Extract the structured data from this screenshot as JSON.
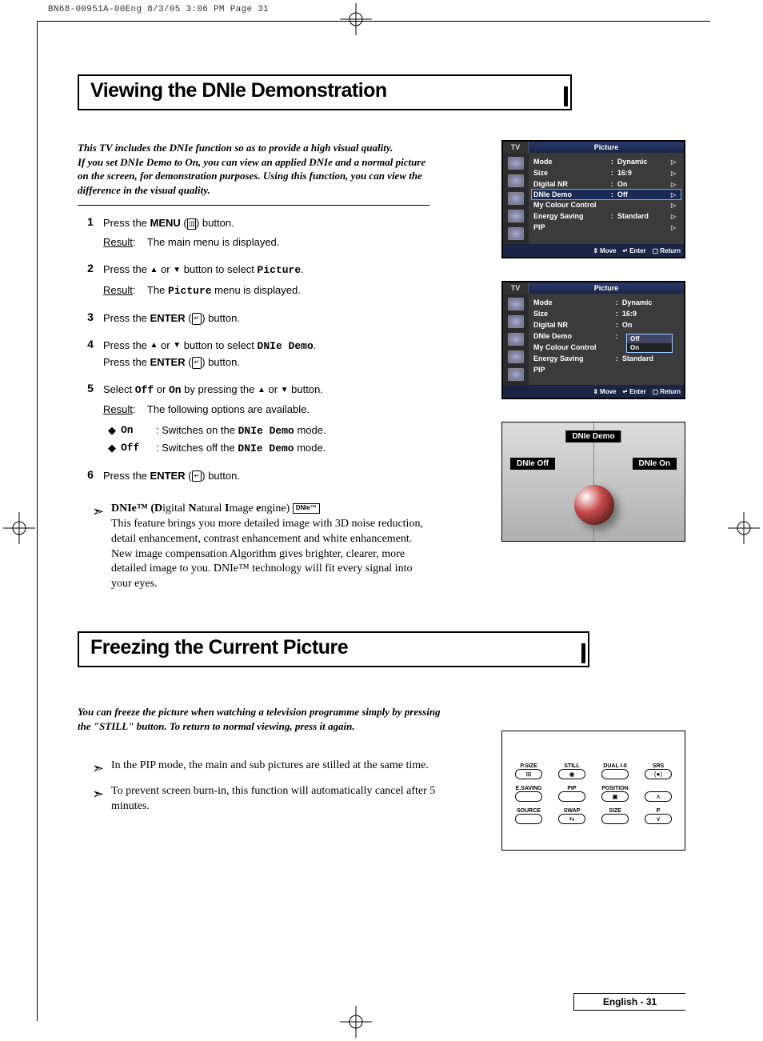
{
  "print_header": "BN68-00951A-00Eng  8/3/05  3:06 PM  Page 31",
  "section1": {
    "title": "Viewing the DNIe Demonstration",
    "intro": "This TV includes the DNIe function so as to provide a high visual quality.\nIf you set DNIe Demo to On, you can view an applied DNIe and a normal picture on the screen, for demonstration purposes. Using this function, you can view the difference in the visual quality.",
    "steps": [
      {
        "num": "1",
        "line1_pre": "Press the ",
        "line1_bold": "MENU",
        "line1_post": " (",
        "line1_icon": "menu",
        "line1_end": ") button.",
        "result_label": "Result",
        "result_text": "The main menu is displayed."
      },
      {
        "num": "2",
        "line1_pre": "Press the ",
        "line1_icon1": "▲",
        "line1_mid": " or ",
        "line1_icon2": "▼",
        "line1_post": " button to select ",
        "line1_mono": "Picture",
        "line1_end": ".",
        "result_label": "Result",
        "result_pre": "The ",
        "result_mono": "Picture",
        "result_post": " menu is displayed."
      },
      {
        "num": "3",
        "line1_pre": "Press the ",
        "line1_bold": "ENTER",
        "line1_post": " (",
        "line1_icon": "enter",
        "line1_end": ") button."
      },
      {
        "num": "4",
        "line1_pre": "Press the ",
        "line1_icon1": "▲",
        "line1_mid": " or ",
        "line1_icon2": "▼",
        "line1_post": " button to select ",
        "line1_mono": "DNIe Demo",
        "line1_end": ".",
        "line2_pre": "Press the ",
        "line2_bold": "ENTER",
        "line2_post": " (",
        "line2_icon": "enter",
        "line2_end": ") button."
      },
      {
        "num": "5",
        "line1_pre": "Select ",
        "line1_mono1": "Off",
        "line1_mid1": " or ",
        "line1_mono2": "On",
        "line1_mid2": " by pressing the ",
        "line1_icon1": "▲",
        "line1_mid3": " or ",
        "line1_icon2": "▼",
        "line1_end": " button.",
        "result_label": "Result",
        "result_text": "The following options are available.",
        "options": [
          {
            "key": "On",
            "val_pre": "Switches on the ",
            "val_mono": "DNIe Demo",
            "val_post": " mode."
          },
          {
            "key": "Off",
            "val_pre": "Switches off the ",
            "val_mono": "DNIe Demo",
            "val_post": " mode."
          }
        ]
      },
      {
        "num": "6",
        "line1_pre": "Press the ",
        "line1_bold": "ENTER",
        "line1_post": " (",
        "line1_icon": "enter",
        "line1_end": ") button."
      }
    ],
    "note": {
      "head_pre": "DNIe™ (",
      "head_d": "D",
      "head_1": "igital ",
      "head_n": "N",
      "head_2": "atural ",
      "head_i": "I",
      "head_3": "mage ",
      "head_e": "e",
      "head_4": "ngine) ",
      "badge": "DNIe™",
      "body": "This feature brings you more detailed image with 3D noise reduction, detail enhancement, contrast enhancement and white enhancement. New image compensation Algorithm gives brighter, clearer, more detailed image to you. DNIe™ technology will fit every signal into your eyes."
    }
  },
  "osd1": {
    "tv_label": "TV",
    "title": "Picture",
    "items": [
      {
        "label": "Mode",
        "val": "Dynamic"
      },
      {
        "label": "Size",
        "val": "16:9"
      },
      {
        "label": "Digital NR",
        "val": "On"
      },
      {
        "label": "DNIe Demo",
        "val": "Off",
        "sel": true
      },
      {
        "label": "My Colour Control",
        "val": ""
      },
      {
        "label": "Energy Saving",
        "val": "Standard"
      },
      {
        "label": "PIP",
        "val": ""
      }
    ],
    "footer": {
      "move": "Move",
      "enter": "Enter",
      "return": "Return"
    }
  },
  "osd2": {
    "tv_label": "TV",
    "title": "Picture",
    "items": [
      {
        "label": "Mode",
        "val": "Dynamic"
      },
      {
        "label": "Size",
        "val": "16:9"
      },
      {
        "label": "Digital NR",
        "val": "On"
      },
      {
        "label": "DNIe Demo",
        "val": ""
      },
      {
        "label": "My Colour Control",
        "val": ""
      },
      {
        "label": "Energy Saving",
        "val": "Standard"
      },
      {
        "label": "PIP",
        "val": ""
      }
    ],
    "popup": {
      "off": "Off",
      "on": "On"
    },
    "footer": {
      "move": "Move",
      "enter": "Enter",
      "return": "Return"
    }
  },
  "dnie_panel": {
    "title": "DNIe Demo",
    "off": "DNIe Off",
    "on": "DNIe On"
  },
  "section2": {
    "title": "Freezing the Current Picture",
    "intro": "You can freeze the picture when watching a television programme simply by pressing the \"STILL\" button. To return to normal viewing, press it again.",
    "notes": [
      "In the PIP mode, the main and sub pictures are stilled at the same time.",
      "To prevent screen burn-in, this function will automatically cancel after 5 minutes."
    ]
  },
  "remote": {
    "row1": [
      "P.SIZE",
      "STILL",
      "DUAL I-II",
      "SRS"
    ],
    "row2": [
      "E.SAVING",
      "PIP",
      "POSITION",
      ""
    ],
    "row3": [
      "SOURCE",
      "SWAP",
      "SIZE",
      "P"
    ]
  },
  "footer": "English - 31"
}
